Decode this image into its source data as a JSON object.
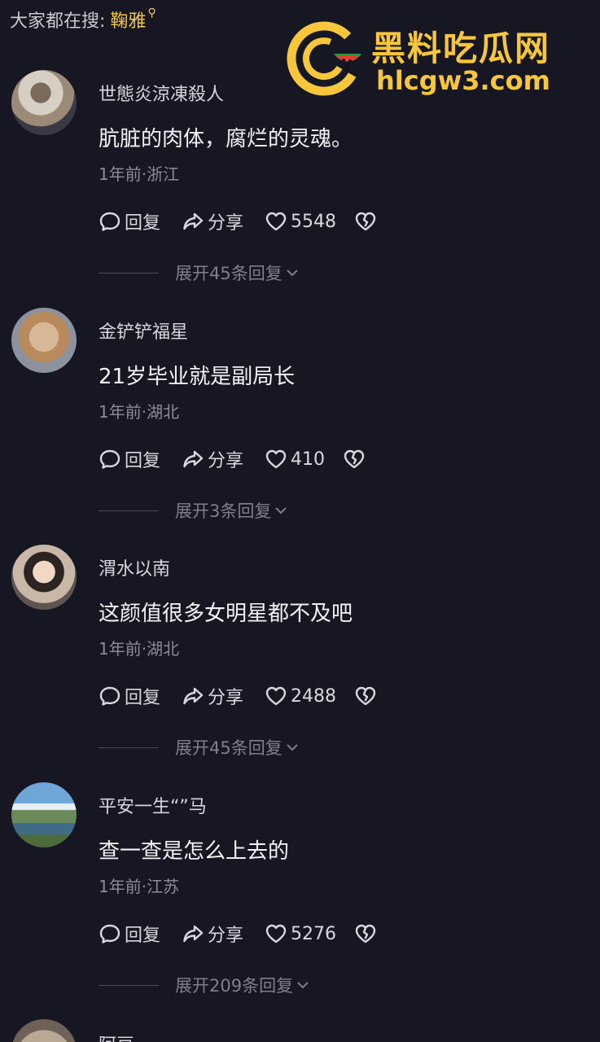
{
  "search": {
    "prefix": "大家都在搜:",
    "term": "鞠雅"
  },
  "watermark": {
    "title": "黑料吃瓜网",
    "url": "hlcgw3.com"
  },
  "actions": {
    "reply": "回复",
    "share": "分享"
  },
  "comments": [
    {
      "username": "世態炎涼凍殺人",
      "content": "肮脏的肉体，腐烂的灵魂。",
      "time": "1年前",
      "location": "浙江",
      "meta": "1年前·浙江",
      "likes": "5548",
      "expand": "展开45条回复"
    },
    {
      "username": "金铲铲福星",
      "content": "21岁毕业就是副局长",
      "time": "1年前",
      "location": "湖北",
      "meta": "1年前·湖北",
      "likes": "410",
      "expand": "展开3条回复"
    },
    {
      "username": "渭水以南",
      "content": "这颜值很多女明星都不及吧",
      "time": "1年前",
      "location": "湖北",
      "meta": "1年前·湖北",
      "likes": "2488",
      "expand": "展开45条回复"
    },
    {
      "username": "平安一生“”马",
      "content": "查一查是怎么上去的",
      "time": "1年前",
      "location": "江苏",
      "meta": "1年前·江苏",
      "likes": "5276",
      "expand": "展开209条回复"
    },
    {
      "username": "阿豆"
    }
  ]
}
